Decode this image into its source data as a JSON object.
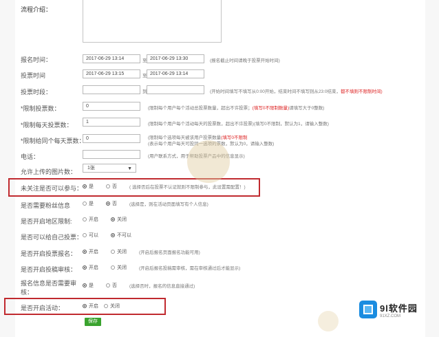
{
  "form": {
    "intro_label": "流程介绍：",
    "signup_time": {
      "label": "报名时间：",
      "start": "2017-06-29 13:14",
      "sep": "至",
      "end": "2017-06-29 13:30",
      "hint": "(报名截止时间请晚于投票开始时间)"
    },
    "vote_time": {
      "label": "投票时间",
      "start": "2017-06-29 13:15",
      "sep": "至",
      "end": "2017-06-29 13:14"
    },
    "vote_period": {
      "label": "投票时段：",
      "sep": "到",
      "hint": "(开始时间填写不填写从0:00开始，结束时间不填写则从23:0结束，",
      "hint_red": "都不填则不限制时间)"
    },
    "limit_votes": {
      "label": "*限制投票数：",
      "value": "0",
      "hint": "(限制每个用户每个活动总投票数量，超出不许投票；",
      "hint_red": "(填写0不限制数量)",
      "hint2": "请填写大于0整数)"
    },
    "limit_daily": {
      "label": "*限制每天投票数：",
      "value": "1",
      "hint": "(限制每个用户每个活动每天的投票数，超出不许投票)",
      "hint2": "(填写0不限制，默认为1，请输入整数)"
    },
    "limit_same": {
      "label": "*限制给同个每天票数：",
      "value": "0",
      "hint": "(限制每个选项每天被该用户投票数量",
      "hint_red": "(填写0不限制",
      "hint2": "(表示每个用户每天可投同一选项的票数，默认为0，请输入整数)"
    },
    "phone": {
      "label": "电话：",
      "hint": "(用户联系方式，用于帮助投票产品中的信息显示)"
    },
    "upload_count": {
      "label": "允许上传的图片数：",
      "value": "1张",
      "caret": "▼"
    },
    "follow": {
      "label": "未关注是否可以参与：",
      "opt_yes": "是",
      "opt_no": "否",
      "hint": "( 选择否后在投票不认证就则不限制参与，此设置需配置！)"
    },
    "need_fans_info": {
      "label": "是否需要粉丝信息",
      "opt_yes": "是",
      "opt_no": "否",
      "hint": "(选择是，则在活动页面填写有个人信息)"
    },
    "region_limit": {
      "label": "是否开启地区限制:",
      "opt_on": "开启",
      "opt_off": "关闭"
    },
    "self_vote": {
      "label": "是否可以给自己投票：",
      "opt_yes": "可以",
      "opt_no": "不可以"
    },
    "signup_enable": {
      "label": "是否开启投票报名：",
      "opt_on": "开启",
      "opt_off": "关闭",
      "hint": "(开启后报名页面报名功能可用)"
    },
    "vote_review": {
      "label": "是否开启投稿审核：",
      "opt_on": "开启",
      "opt_off": "关闭",
      "hint": "(开启后报名投稿需审核，需在审核通过后才能显示)"
    },
    "info_review": {
      "label": "报名信息是否需要审",
      "label2": "核：",
      "opt_yes": "是",
      "opt_no": "否",
      "hint": "(选择否时，报名的信息直接通过)"
    },
    "activity_enable": {
      "label": "是否开启活动：",
      "opt_on": "开启",
      "opt_off": "关闭"
    },
    "submit_label": "保存"
  },
  "logo": {
    "title": "9l软件园",
    "url": "91XZ.COM"
  },
  "colors": {
    "highlight": "#c0292e",
    "submit": "#3aa32e",
    "logo_blue": "#1a8ce0"
  }
}
